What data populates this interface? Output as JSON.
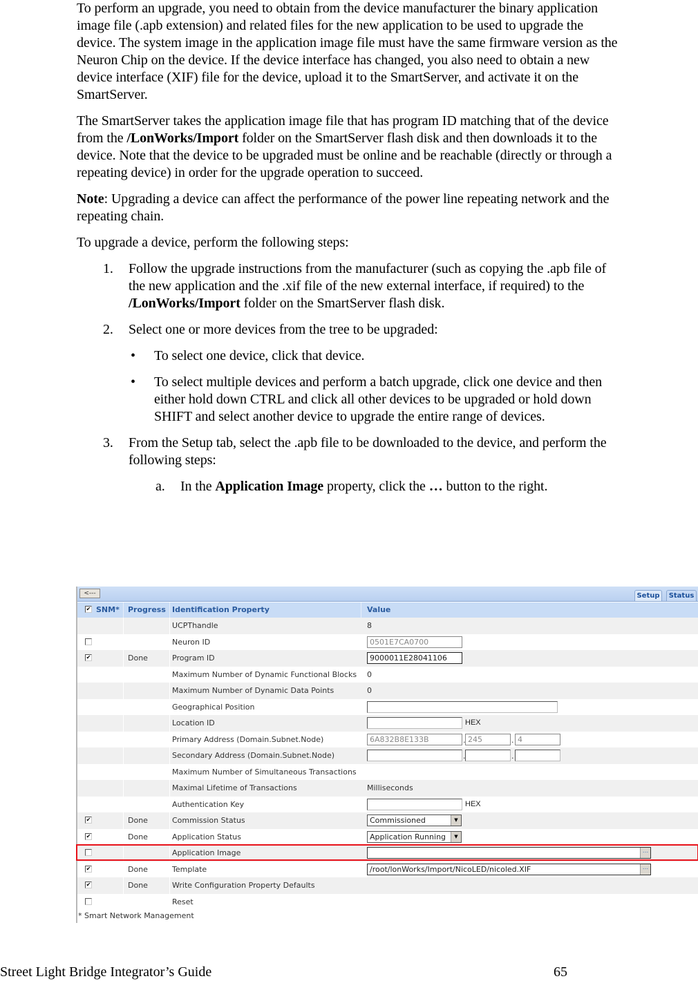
{
  "document": {
    "para1": "To perform an upgrade, you need to obtain from the device manufacturer the binary application image file (.apb extension) and related files for the new application to be used to upgrade the device.  The system image in the application image file must have the same firmware version as the Neuron Chip on the device.  If the device interface has changed, you also need to obtain a new device interface (XIF) file for the device, upload it to the SmartServer, and activate it on the SmartServer.",
    "para2_before": "The SmartServer takes the application image file that has program ID matching that of the device from the ",
    "para2_bold": "/LonWorks/Import",
    "para2_after": " folder on the SmartServer flash disk and then downloads it to the device.  Note that the device to be upgraded must be online and be reachable (directly or through a repeating device) in order for the upgrade operation to succeed.",
    "note_label": "Note",
    "note_text": ":  Upgrading a device can affect the performance of the power line repeating network and the repeating chain.",
    "steps_intro": "To upgrade a device, perform the following steps:",
    "steps": [
      {
        "num": "1.",
        "before": "Follow the upgrade instructions from the manufacturer (such as copying the .apb file of the new application and the .xif file of the new external interface, if required) to the ",
        "bold": "/LonWorks/Import",
        "after": " folder on the SmartServer flash disk."
      },
      {
        "num": "2.",
        "text": "Select one or more devices from the tree to be upgraded:",
        "bullets": [
          "To select one device, click that device.",
          "To select multiple devices and perform a batch upgrade, click one device and then either hold down CTRL and click all other devices to be upgraded or hold down SHIFT and select another device to upgrade the entire range of devices."
        ]
      },
      {
        "num": "3.",
        "text": "From the Setup tab, select the .apb file to be downloaded to the device, and perform the following steps:",
        "substeps": [
          {
            "num": "a.",
            "before": "In the ",
            "bold": "Application Image",
            "middle": " property, click the ",
            "bold2": "…",
            "after": " button to the right."
          }
        ]
      }
    ]
  },
  "screenshot": {
    "back_button": "<---",
    "tabs": [
      {
        "label": "Setup",
        "active": true
      },
      {
        "label": "Status",
        "active": false
      }
    ],
    "columns": {
      "snm": "SNM*",
      "progress": "Progress",
      "property": "Identification Property",
      "value": "Value"
    },
    "header_snm_checked": true,
    "rows": [
      {
        "checkbox": null,
        "progress": "",
        "property": "UCPThandle",
        "value_text": "8"
      },
      {
        "checkbox": false,
        "progress": "",
        "property": "Neuron ID",
        "input": "0501E7CA0700",
        "input_disabled": true
      },
      {
        "checkbox": true,
        "progress": "Done",
        "property": "Program ID",
        "input": "9000011E28041106"
      },
      {
        "checkbox": null,
        "progress": "",
        "property": "Maximum Number of Dynamic Functional Blocks",
        "value_text": "0"
      },
      {
        "checkbox": null,
        "progress": "",
        "property": "Maximum Number of Dynamic Data Points",
        "value_text": "0"
      },
      {
        "checkbox": null,
        "progress": "",
        "property": "Geographical Position",
        "input": ""
      },
      {
        "checkbox": null,
        "progress": "",
        "property": "Location ID",
        "input": "",
        "suffix": "HEX"
      },
      {
        "checkbox": null,
        "progress": "",
        "property": "Primary Address (Domain.Subnet.Node)",
        "address": [
          "6A832B8E133B",
          "245",
          "4"
        ],
        "input_disabled": true
      },
      {
        "checkbox": null,
        "progress": "",
        "property": "Secondary Address (Domain.Subnet.Node)",
        "address": [
          "",
          "",
          ""
        ]
      },
      {
        "checkbox": null,
        "progress": "",
        "property": "Maximum Number of Simultaneous Transactions",
        "value_text": ""
      },
      {
        "checkbox": null,
        "progress": "",
        "property": "Maximal Lifetime of Transactions",
        "value_text": "Milliseconds"
      },
      {
        "checkbox": null,
        "progress": "",
        "property": "Authentication Key",
        "input": "",
        "suffix": "HEX"
      },
      {
        "checkbox": true,
        "progress": "Done",
        "property": "Commission Status",
        "select": "Commissioned"
      },
      {
        "checkbox": true,
        "progress": "Done",
        "property": "Application Status",
        "select": "Application Running"
      },
      {
        "checkbox": false,
        "progress": "",
        "property": "Application Image",
        "file": "",
        "highlighted": true
      },
      {
        "checkbox": true,
        "progress": "Done",
        "property": "Template",
        "file": "/root/lonWorks/Import/NicoLED/nicoled.XIF"
      },
      {
        "checkbox": true,
        "progress": "Done",
        "property": "Write Configuration Property Defaults"
      },
      {
        "checkbox": false,
        "progress": "",
        "property": "Reset"
      }
    ],
    "ellipsis_label": "...",
    "footnote": "* Smart Network Management",
    "highlight_color": "#e8121a"
  },
  "footer": {
    "title": "Street Light Bridge Integrator’s Guide",
    "page": "65"
  }
}
